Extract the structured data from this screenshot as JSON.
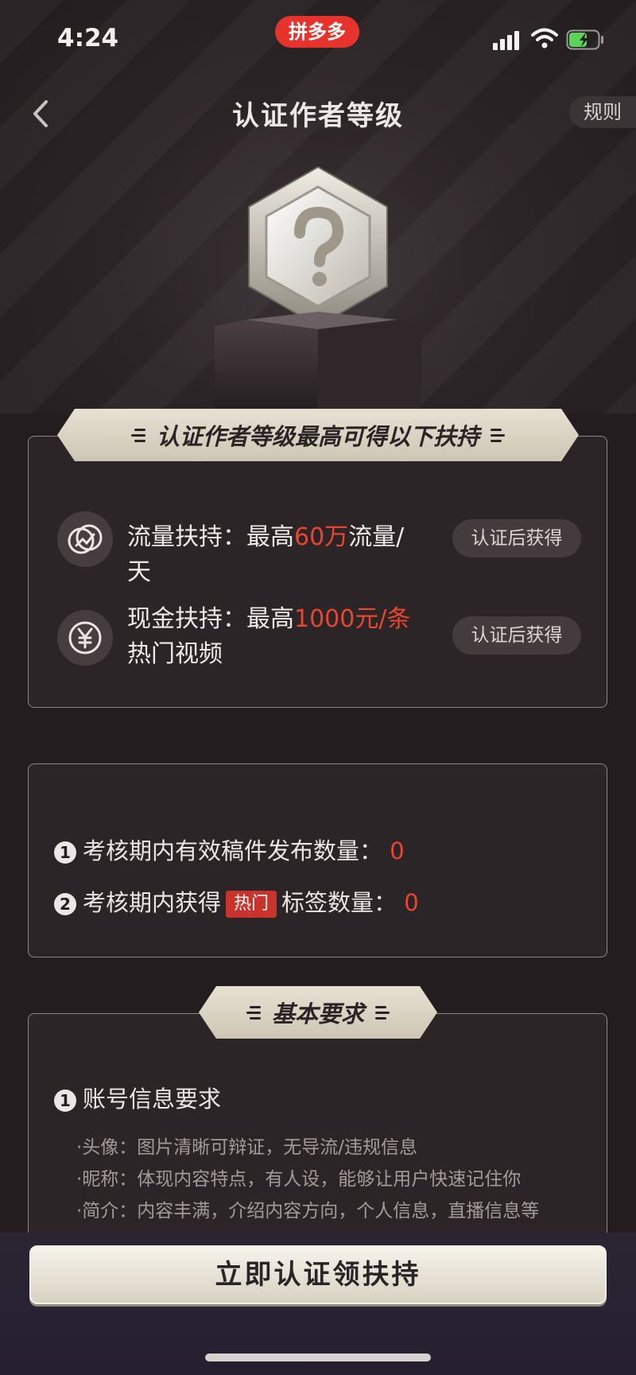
{
  "status_bar": {
    "time": "4:24",
    "app_badge": "拼多多"
  },
  "nav": {
    "title": "认证作者等级",
    "rules_label": "规则"
  },
  "banner_support": "认证作者等级最高可得以下扶持",
  "support": [
    {
      "icon": "traffic-icon",
      "prefix": "流量扶持：最高",
      "highlight": "60万",
      "suffix": "流量/天",
      "status": "认证后获得"
    },
    {
      "icon": "yen-icon",
      "prefix": "现金扶持：最高",
      "highlight": "1000元/条",
      "suffix": "热门视频",
      "status": "认证后获得"
    }
  ],
  "progress": {
    "item1_index": "1",
    "item1_label": "考核期内有效稿件发布数量：",
    "item1_value": "0",
    "item2_index": "2",
    "item2_label_before": "考核期内获得",
    "item2_tag": "热门",
    "item2_label_after": "标签数量：",
    "item2_value": "0"
  },
  "banner_basic": "基本要求",
  "requirements": {
    "index": "1",
    "title": "账号信息要求",
    "lines": [
      "·头像：图片清晰可辩证，无导流/违规信息",
      "·昵称：体现内容特点，有人设，能够让用户快速记住你",
      "·简介：内容丰满，介绍内容方向，个人信息，直播信息等"
    ]
  },
  "cta_label": "立即认证领扶持",
  "colors": {
    "background": "#231d1f",
    "accent_red": "#e9452f",
    "banner_cream": "#e6e1d3",
    "card_border": "#8e8583"
  }
}
